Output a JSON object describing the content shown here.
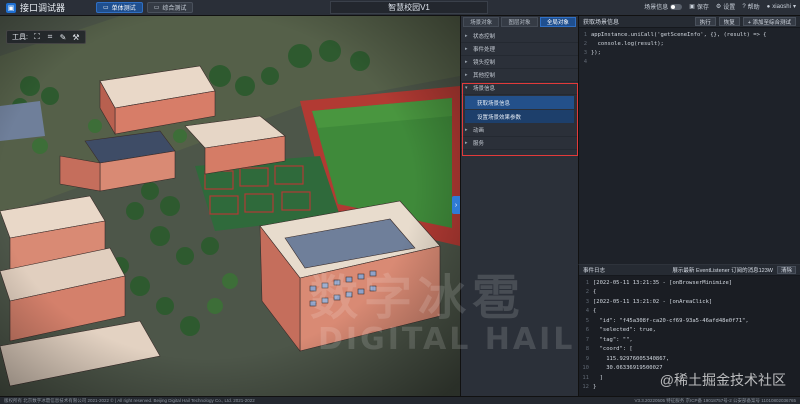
{
  "app": {
    "title": "接口调试器",
    "tabs": [
      "单体测试",
      "综合测试"
    ],
    "scene_title": "智慧校园V1"
  },
  "top_right": {
    "scene_info": "场景信息",
    "save": "保存",
    "settings": "设置",
    "help": "帮助",
    "user": "xiaoshi"
  },
  "toolbar": {
    "label": "工具:"
  },
  "object_panel": {
    "tabs": [
      "场景对象",
      "图层对象",
      "全局对象"
    ],
    "active_tab": "全局对象",
    "items": [
      "状态控制",
      "事件处理",
      "镜头控制",
      "其他控制"
    ],
    "expanded": "场景信息",
    "sub_items": [
      "获取场景信息",
      "设置场景效果参数"
    ],
    "after": [
      "动画",
      "服务"
    ]
  },
  "code_panel": {
    "title": "获取场景信息",
    "buttons": [
      "执行",
      "恢复",
      "+ 添加至综合测试"
    ],
    "lines": [
      "appInstance.uniCall('getSceneInfo', {}, (result) => {",
      "  console.log(result);",
      "});",
      ""
    ]
  },
  "log_panel": {
    "title": "事件日志",
    "listener": "展示最新 EventListener 订阅的消息123W",
    "clear": "清除",
    "lines": [
      "[2022-05-11 13:21:35 - [onBrowserMinimize]",
      "{",
      "[2022-05-11 13:21:02 - [onAreaClick]",
      "{",
      "  \"id\": \"f45a308f-ca20-cf69-93a5-46afd48e0f71\",",
      "  \"selected\": true,",
      "  \"tag\": \"\",",
      "  \"coord\": [",
      "    115.92976005340867,",
      "    30.06336919500027",
      "  ]",
      "}"
    ]
  },
  "status": {
    "left": "版权所有 北京数字冰雹信息技术有限公司 2021-2022 © | All right reserved. Beijing Digital Hail Technology Co., Ltd. 2021-2022",
    "right": "V3.3.20220505 特征服务 京ICP备 19018757号-2 公安部备案号 11010802036765"
  },
  "watermark": {
    "big": "数字冰雹",
    "sub": "DIGITAL HAIL",
    "corner": "@稀土掘金技术社区"
  },
  "colors": {
    "accent": "#1f4f8f",
    "highlight": "#e23a3a"
  }
}
